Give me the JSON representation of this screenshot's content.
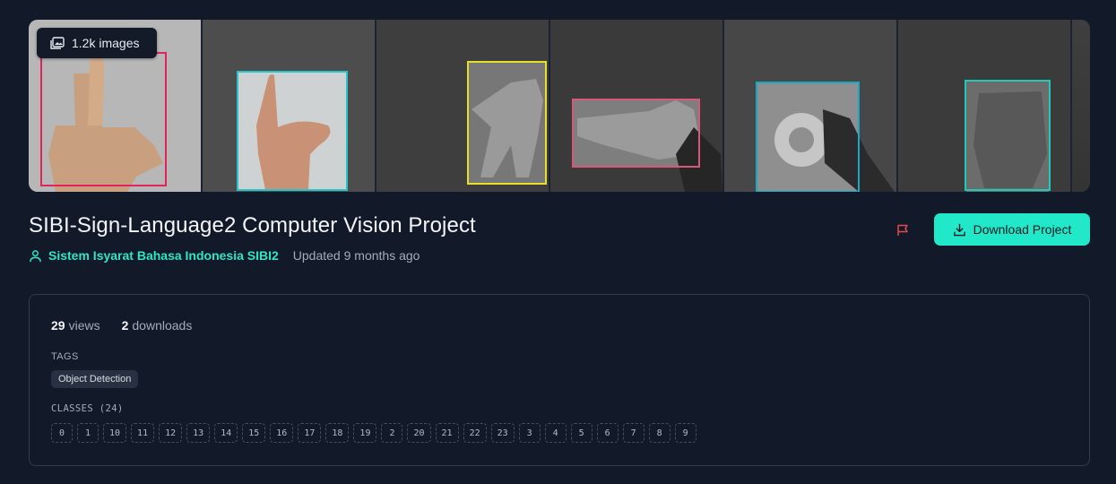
{
  "gallery": {
    "image_count": "1.2k images"
  },
  "project": {
    "title": "SIBI-Sign-Language2 Computer Vision Project",
    "owner": "Sistem Isyarat Bahasa Indonesia SIBI2",
    "updated": "Updated 9 months ago",
    "download_label": "Download Project"
  },
  "stats": {
    "views_count": "29",
    "views_label": "views",
    "downloads_count": "2",
    "downloads_label": "downloads"
  },
  "tags": {
    "heading": "TAGS",
    "items": [
      "Object Detection"
    ]
  },
  "classes": {
    "heading": "CLASSES (24)",
    "items": [
      "0",
      "1",
      "10",
      "11",
      "12",
      "13",
      "14",
      "15",
      "16",
      "17",
      "18",
      "19",
      "2",
      "20",
      "21",
      "22",
      "23",
      "3",
      "4",
      "5",
      "6",
      "7",
      "8",
      "9"
    ]
  },
  "colors": {
    "accent": "#20e8c9",
    "owner_link": "#2ee6c3",
    "flag": "#e5484d",
    "background": "#121a2a",
    "bbox_colors": [
      "#e0245e",
      "#27c4cc",
      "#e6e02a",
      "#d8577a",
      "#1aa8c7",
      "#1fc9b8"
    ]
  },
  "icons": {
    "image_count": "images-icon",
    "owner": "user-icon",
    "report": "flag-icon",
    "download": "download-icon"
  }
}
